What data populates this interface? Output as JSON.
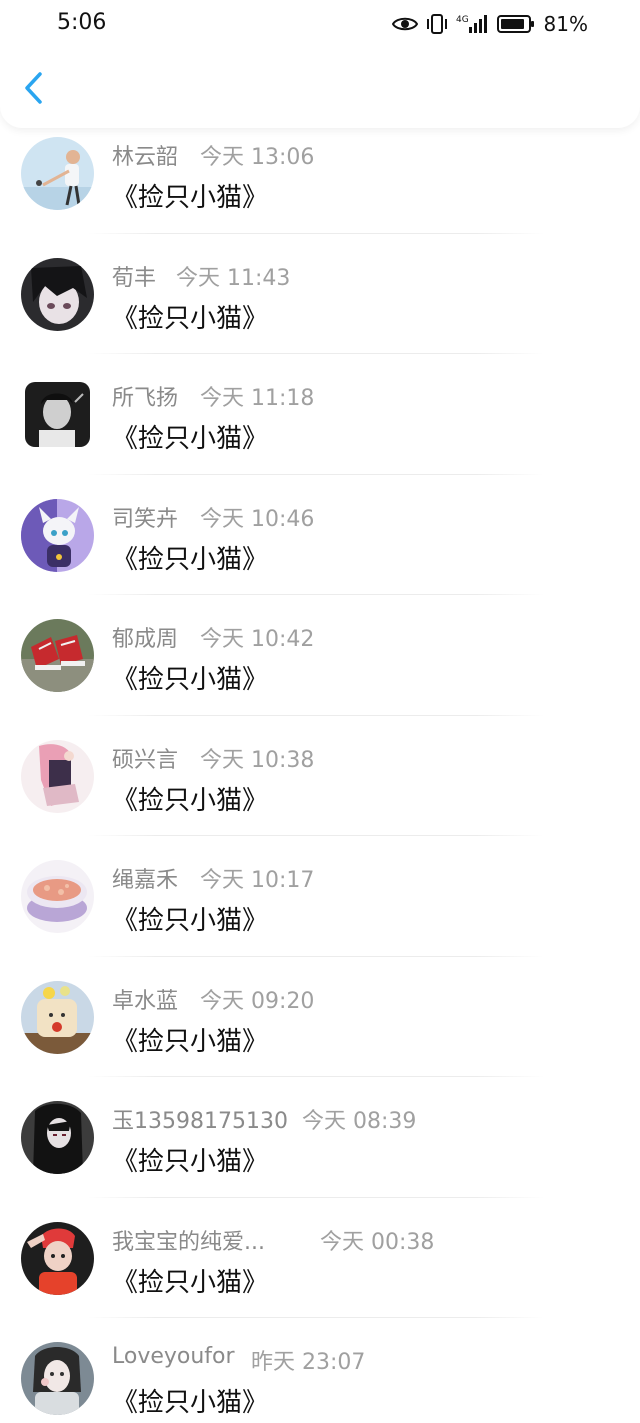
{
  "status_bar": {
    "time": "5:06",
    "network": "4G",
    "battery_percent": "81%"
  },
  "nav": {
    "back_icon": "chevron-left-icon",
    "accent_color": "#2aa5f0"
  },
  "messages": [
    {
      "name": "林云韶",
      "time": "今天 13:06",
      "text": "《捡只小猫》",
      "avatar_bg": "#cfe4f2"
    },
    {
      "name": "荀丰",
      "time": "今天 11:43",
      "text": "《捡只小猫》",
      "avatar_bg": "#2b2b2e"
    },
    {
      "name": "所飞扬",
      "time": "今天 11:18",
      "text": "《捡只小猫》",
      "avatar_bg": "#3a3a3a"
    },
    {
      "name": "司笑卉",
      "time": "今天 10:46",
      "text": "《捡只小猫》",
      "avatar_bg": "#6d5ab8"
    },
    {
      "name": "郁成周",
      "time": "今天 10:42",
      "text": "《捡只小猫》",
      "avatar_bg": "#6b7a5c"
    },
    {
      "name": "硕兴言",
      "time": "今天 10:38",
      "text": "《捡只小猫》",
      "avatar_bg": "#f3e6ea"
    },
    {
      "name": "绳嘉禾",
      "time": "今天 10:17",
      "text": "《捡只小猫》",
      "avatar_bg": "#e9e4f0"
    },
    {
      "name": "卓水蓝",
      "time": "今天 09:20",
      "text": "《捡只小猫》",
      "avatar_bg": "#c9d8e6"
    },
    {
      "name": "玉13598175130",
      "time": "今天 08:39",
      "text": "《捡只小猫》",
      "avatar_bg": "#3c3c3c"
    },
    {
      "name": "我宝宝的纯爱...",
      "time": "今天 00:38",
      "text": "《捡只小猫》",
      "avatar_bg": "#1e1e1e"
    },
    {
      "name": "Loveyoufor",
      "time": "昨天 23:07",
      "text": "《捡只小猫》",
      "avatar_bg": "#7d8a94"
    }
  ]
}
